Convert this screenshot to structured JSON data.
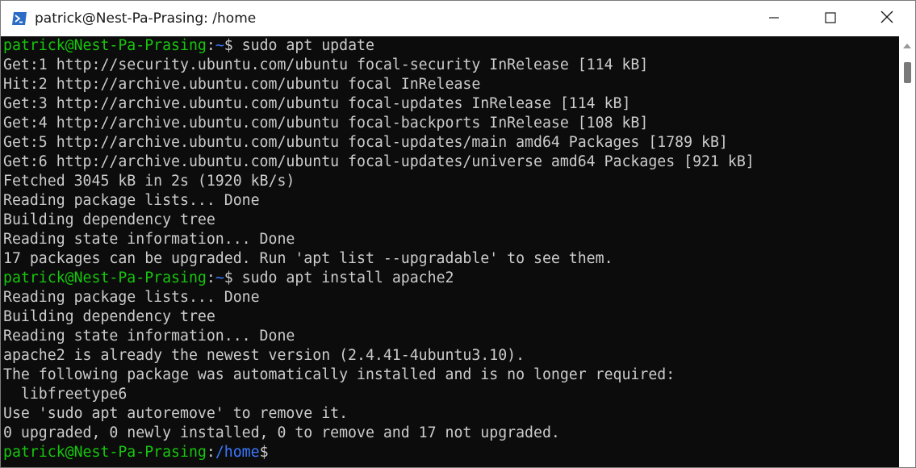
{
  "window": {
    "title": "patrick@Nest-Pa-Prasing: /home",
    "icon": "powershell-terminal-icon",
    "controls": [
      "minimize",
      "maximize",
      "close"
    ]
  },
  "colors": {
    "background": "#0c0c0c",
    "text": "#cccccc",
    "prompt_user": "#16c60c",
    "prompt_path": "#3b78ff"
  },
  "terminal": {
    "prompt_user": "patrick@Nest-Pa-Prasing",
    "lines": [
      {
        "type": "prompt",
        "path": "~",
        "command": " sudo apt update"
      },
      {
        "type": "output",
        "text": "Get:1 http://security.ubuntu.com/ubuntu focal-security InRelease [114 kB]"
      },
      {
        "type": "output",
        "text": "Hit:2 http://archive.ubuntu.com/ubuntu focal InRelease"
      },
      {
        "type": "output",
        "text": "Get:3 http://archive.ubuntu.com/ubuntu focal-updates InRelease [114 kB]"
      },
      {
        "type": "output",
        "text": "Get:4 http://archive.ubuntu.com/ubuntu focal-backports InRelease [108 kB]"
      },
      {
        "type": "output",
        "text": "Get:5 http://archive.ubuntu.com/ubuntu focal-updates/main amd64 Packages [1789 kB]"
      },
      {
        "type": "output",
        "text": "Get:6 http://archive.ubuntu.com/ubuntu focal-updates/universe amd64 Packages [921 kB]"
      },
      {
        "type": "output",
        "text": "Fetched 3045 kB in 2s (1920 kB/s)"
      },
      {
        "type": "output",
        "text": "Reading package lists... Done"
      },
      {
        "type": "output",
        "text": "Building dependency tree"
      },
      {
        "type": "output",
        "text": "Reading state information... Done"
      },
      {
        "type": "output",
        "text": "17 packages can be upgraded. Run 'apt list --upgradable' to see them."
      },
      {
        "type": "prompt",
        "path": "~",
        "command": " sudo apt install apache2"
      },
      {
        "type": "output",
        "text": "Reading package lists... Done"
      },
      {
        "type": "output",
        "text": "Building dependency tree"
      },
      {
        "type": "output",
        "text": "Reading state information... Done"
      },
      {
        "type": "output",
        "text": "apache2 is already the newest version (2.4.41-4ubuntu3.10)."
      },
      {
        "type": "output",
        "text": "The following package was automatically installed and is no longer required:"
      },
      {
        "type": "output",
        "text": "  libfreetype6"
      },
      {
        "type": "output",
        "text": "Use 'sudo apt autoremove' to remove it."
      },
      {
        "type": "output",
        "text": "0 upgraded, 0 newly installed, 0 to remove and 17 not upgraded."
      },
      {
        "type": "prompt",
        "path": "/home",
        "command": ""
      }
    ]
  }
}
